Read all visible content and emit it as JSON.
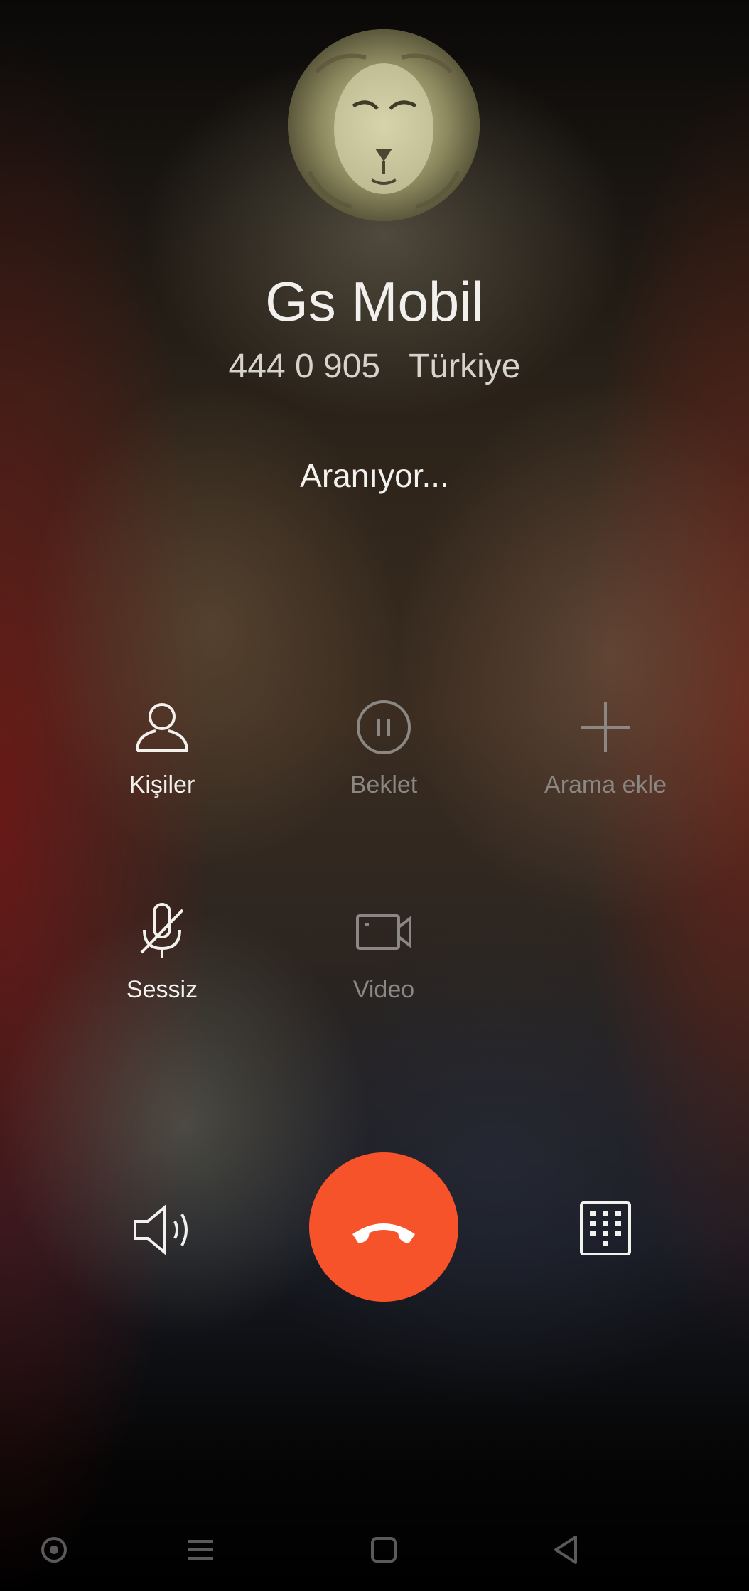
{
  "contact": {
    "name": "Gs Mobil",
    "number": "444 0 905",
    "location": "Türkiye",
    "avatar_icon": "lion-photo"
  },
  "call": {
    "status": "Aranıyor..."
  },
  "actions": {
    "contacts": {
      "label": "Kişiler",
      "icon": "person-icon",
      "enabled": true
    },
    "hold": {
      "label": "Beklet",
      "icon": "pause-icon",
      "enabled": false
    },
    "add_call": {
      "label": "Arama ekle",
      "icon": "plus-icon",
      "enabled": false
    },
    "mute": {
      "label": "Sessiz",
      "icon": "mic-off-icon",
      "enabled": true
    },
    "video": {
      "label": "Video",
      "icon": "video-camera-icon",
      "enabled": false
    }
  },
  "bottom": {
    "speaker_icon": "speaker-icon",
    "end_call_icon": "hang-up-icon",
    "end_call_color": "#f6532a",
    "keypad_icon": "dialpad-icon"
  },
  "navigation": {
    "items": [
      "screen-recorder-icon",
      "menu-icon",
      "home-icon",
      "back-icon"
    ]
  }
}
